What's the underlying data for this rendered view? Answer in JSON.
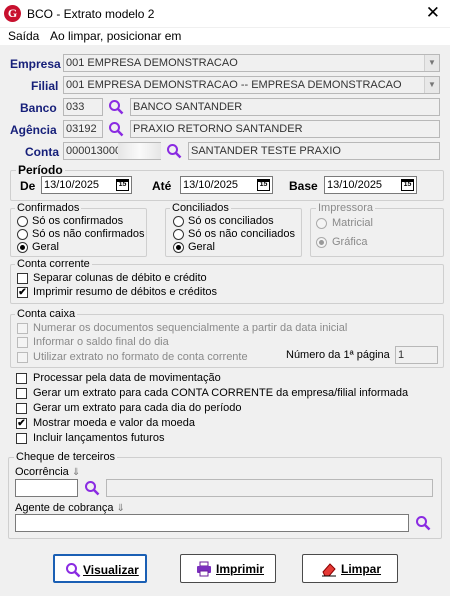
{
  "window": {
    "title": "BCO - Extrato modelo 2",
    "close": "✕",
    "logo_letter": "G"
  },
  "menu": {
    "items": [
      "Saída",
      "Ao limpar, posicionar em"
    ]
  },
  "empresa": {
    "label": "Empresa",
    "value": "001 EMPRESA DEMONSTRACAO"
  },
  "filial": {
    "label": "Filial",
    "value": "001 EMPRESA DEMONSTRACAO -- EMPRESA DEMONSTRACAO"
  },
  "banco": {
    "label": "Banco",
    "code": "033",
    "name": "BANCO SANTANDER"
  },
  "agencia": {
    "label": "Agência",
    "code": "03192",
    "name": "PRAXIO RETORNO SANTANDER"
  },
  "conta": {
    "label": "Conta",
    "code": "000013000",
    "name": "SANTANDER TESTE PRAXIO"
  },
  "periodo": {
    "title": "Período",
    "de_label": "De",
    "de_value": "13/10/2025",
    "ate_label": "Até",
    "ate_value": "13/10/2025",
    "base_label": "Base",
    "base_value": "13/10/2025",
    "cal_text": "15"
  },
  "confirmados": {
    "title": "Confirmados",
    "options": [
      "Só os confirmados",
      "Só os não confirmados",
      "Geral"
    ],
    "selected": "Geral"
  },
  "conciliados": {
    "title": "Conciliados",
    "options": [
      "Só os conciliados",
      "Só os não conciliados",
      "Geral"
    ],
    "selected": "Geral"
  },
  "impressora": {
    "title": "Impressora",
    "options": [
      "Matricial",
      "Gráfica"
    ],
    "selected": "Gráfica"
  },
  "conta_corrente": {
    "title": "Conta corrente",
    "options": [
      {
        "label": "Separar colunas de débito e crédito",
        "checked": false
      },
      {
        "label": "Imprimir resumo de débitos e créditos",
        "checked": true
      }
    ]
  },
  "conta_caixa": {
    "title": "Conta caixa",
    "options": [
      {
        "label": "Numerar os documentos sequencialmente a partir da data inicial",
        "checked": false
      },
      {
        "label": "Informar o saldo final do dia",
        "checked": false
      },
      {
        "label": "Utilizar extrato no formato de conta corrente",
        "checked": false
      }
    ],
    "pagina_label": "Número da 1ª página",
    "pagina_value": "1"
  },
  "opcoes": [
    {
      "label": "Processar pela data de movimentação",
      "checked": false
    },
    {
      "label": "Gerar um extrato para cada CONTA CORRENTE da empresa/filial informada",
      "checked": false
    },
    {
      "label": "Gerar um extrato para cada dia do período",
      "checked": false
    },
    {
      "label": "Mostrar moeda e valor da moeda",
      "checked": true
    },
    {
      "label": "Incluir lançamentos futuros",
      "checked": false
    }
  ],
  "cheque": {
    "title": "Cheque de terceiros",
    "ocorrencia_label": "Ocorrência",
    "ocorrencia_value": "",
    "agente_label": "Agente de cobrança",
    "agente_value": "",
    "sort_icon": "⇓"
  },
  "buttons": {
    "visualizar": "Visualizar",
    "imprimir": "Imprimir",
    "limpar": "Limpar"
  },
  "check_mark": "✔",
  "colors": {
    "label_blue": "#17207a",
    "search_icon": "#8a2be2",
    "logo_red": "#c8102e",
    "default_button": "#1a5fb4"
  }
}
